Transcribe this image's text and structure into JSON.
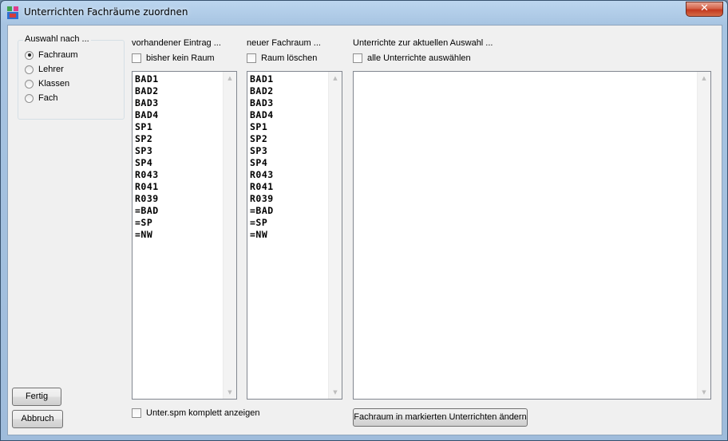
{
  "window": {
    "title": "Unterrichten Fachräume zuordnen",
    "close_label": "✕"
  },
  "selection_group": {
    "legend": "Auswahl nach ...",
    "options": [
      {
        "label": "Fachraum",
        "checked": true
      },
      {
        "label": "Lehrer",
        "checked": false
      },
      {
        "label": "Klassen",
        "checked": false
      },
      {
        "label": "Fach",
        "checked": false
      }
    ]
  },
  "existing_column": {
    "heading": "vorhandener Eintrag ...",
    "checkbox_label": "bisher kein Raum",
    "checkbox_checked": false,
    "items": [
      "BAD1",
      "BAD2",
      "BAD3",
      "BAD4",
      "SP1",
      "SP2",
      "SP3",
      "SP4",
      "R043",
      "R041",
      "R039",
      "=BAD",
      "=SP",
      "=NW"
    ]
  },
  "new_column": {
    "heading": "neuer Fachraum ...",
    "checkbox_label": "Raum löschen",
    "checkbox_checked": false,
    "items": [
      "BAD1",
      "BAD2",
      "BAD3",
      "BAD4",
      "SP1",
      "SP2",
      "SP3",
      "SP4",
      "R043",
      "R041",
      "R039",
      "=BAD",
      "=SP",
      "=NW"
    ]
  },
  "lessons_column": {
    "heading": "Unterrichte zur aktuellen Auswahl ...",
    "checkbox_label": "alle Unterrichte auswählen",
    "checkbox_checked": false,
    "items": []
  },
  "bottom": {
    "show_full_label": "Unter.spm komplett anzeigen",
    "show_full_checked": false,
    "change_button": "Fachraum in markierten Unterrichten ändern",
    "done_button": "Fertig",
    "cancel_button": "Abbruch"
  },
  "icons": {
    "app": "schedule-app-icon",
    "close": "close-icon",
    "scroll_up": "scroll-up-arrow-icon",
    "scroll_down": "scroll-down-arrow-icon"
  },
  "colors": {
    "title_bar": "#a7c4e2",
    "client_bg": "#f0f0f0",
    "close_button": "#c2391f",
    "listbox_bg": "#ffffff"
  }
}
